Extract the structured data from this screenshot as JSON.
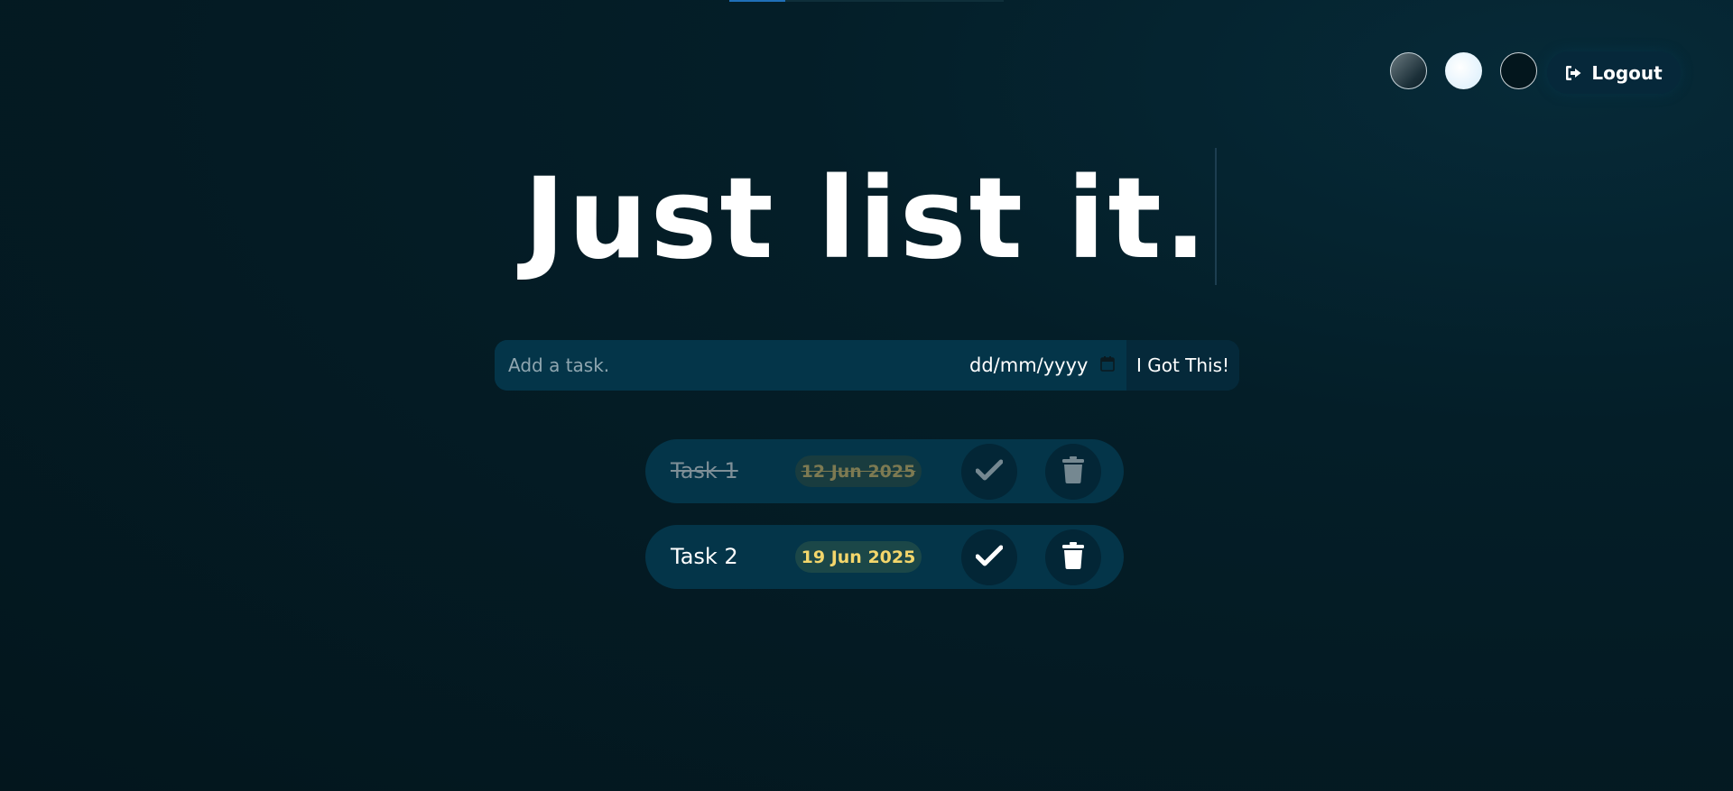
{
  "header": {
    "theme_options": [
      {
        "name": "standard",
        "color": "#3b4d55"
      },
      {
        "name": "light",
        "color": "#e6f5fd"
      },
      {
        "name": "darker",
        "color": "#03161d"
      }
    ],
    "logout_label": "Logout"
  },
  "title": "Just list it.",
  "form": {
    "task_placeholder": "Add a task.",
    "date_placeholder": "dd/mm/yyyy",
    "submit_label": "I Got This!"
  },
  "tasks": [
    {
      "name": "Task 1",
      "date": "12 Jun 2025",
      "completed": true
    },
    {
      "name": "Task 2",
      "date": "19 Jun 2025",
      "completed": false
    }
  ],
  "colors": {
    "background": "#03161d",
    "panel": "#043549",
    "accent_date": "#f3d66b",
    "top_indicator": "#1f6fb8"
  },
  "icons": {
    "logout": "logout-icon",
    "calendar": "calendar-icon",
    "check": "check-icon",
    "trash": "trash-icon"
  }
}
